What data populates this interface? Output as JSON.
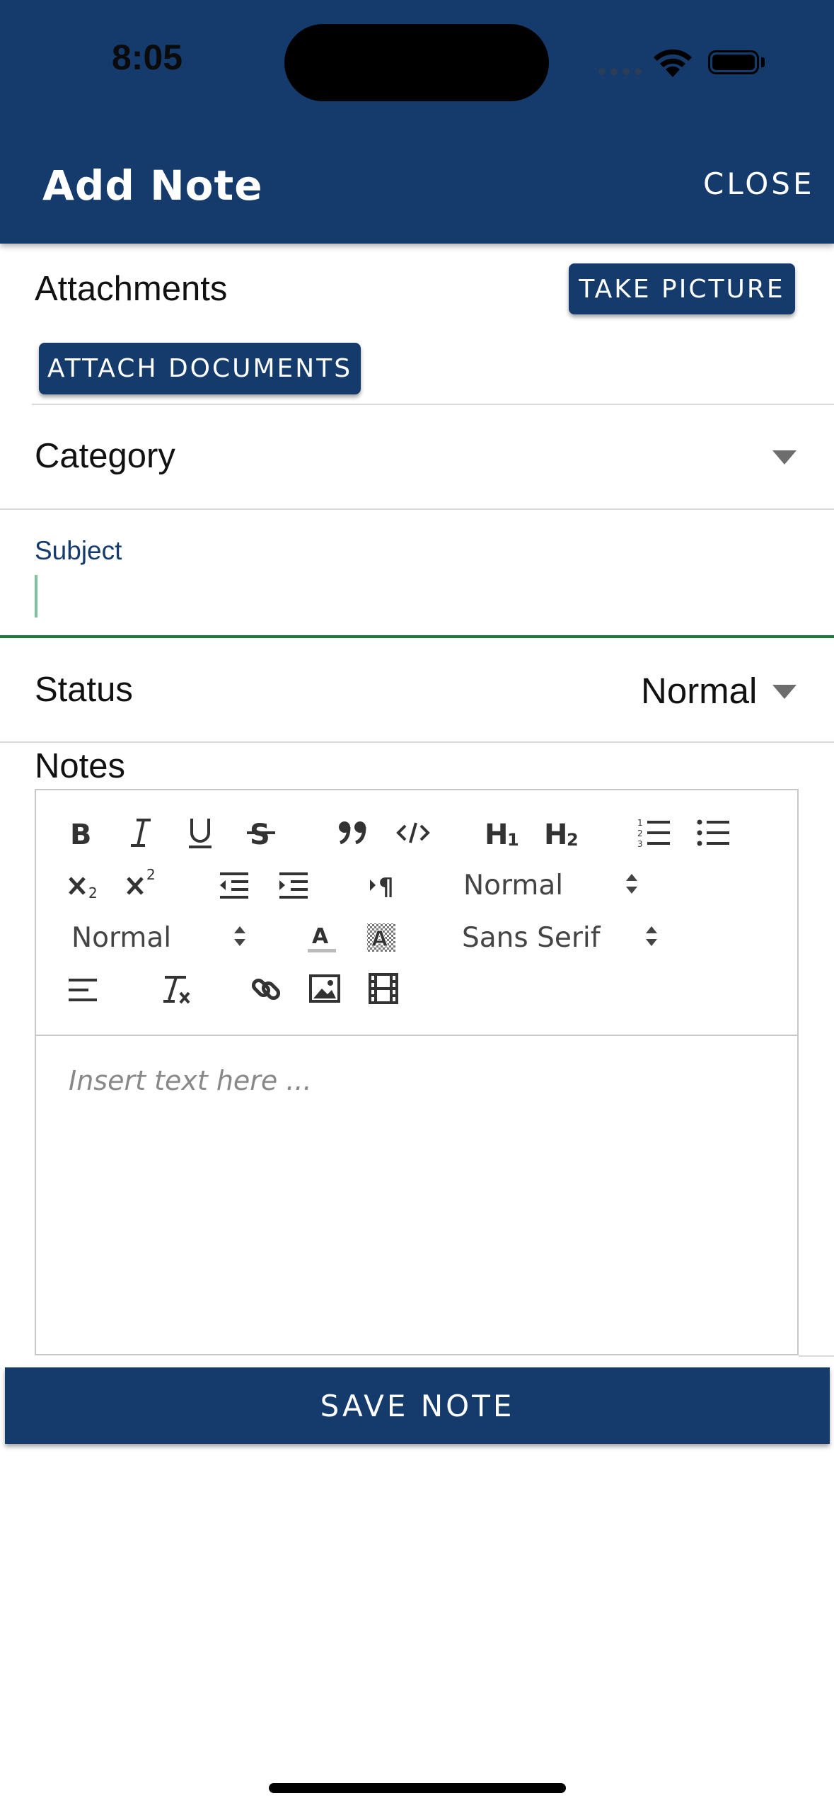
{
  "status_bar": {
    "time": "8:05"
  },
  "header": {
    "title": "Add Note",
    "close_label": "CLOSE"
  },
  "attachments": {
    "label": "Attachments",
    "take_picture_label": "TAKE PICTURE",
    "attach_documents_label": "ATTACH DOCUMENTS"
  },
  "category": {
    "label": "Category",
    "value": ""
  },
  "subject": {
    "label": "Subject",
    "value": ""
  },
  "status": {
    "label": "Status",
    "value": "Normal"
  },
  "notes": {
    "label": "Notes",
    "placeholder": "Insert text here ...",
    "toolbar": {
      "header_select": "Normal",
      "size_select": "Normal",
      "font_select": "Sans Serif",
      "icons": [
        "bold-icon",
        "italic-icon",
        "underline-icon",
        "strike-icon",
        "blockquote-icon",
        "code-icon",
        "h1-icon",
        "h2-icon",
        "ordered-list-icon",
        "bullet-list-icon",
        "subscript-icon",
        "superscript-icon",
        "outdent-icon",
        "indent-icon",
        "rtl-direction-icon",
        "text-color-icon",
        "background-color-icon",
        "align-icon",
        "clear-format-icon",
        "link-icon",
        "image-icon",
        "video-icon"
      ]
    }
  },
  "save_label": "SAVE NOTE",
  "colors": {
    "brand": "#143b6c",
    "subject_focus": "#1a7a3a"
  }
}
